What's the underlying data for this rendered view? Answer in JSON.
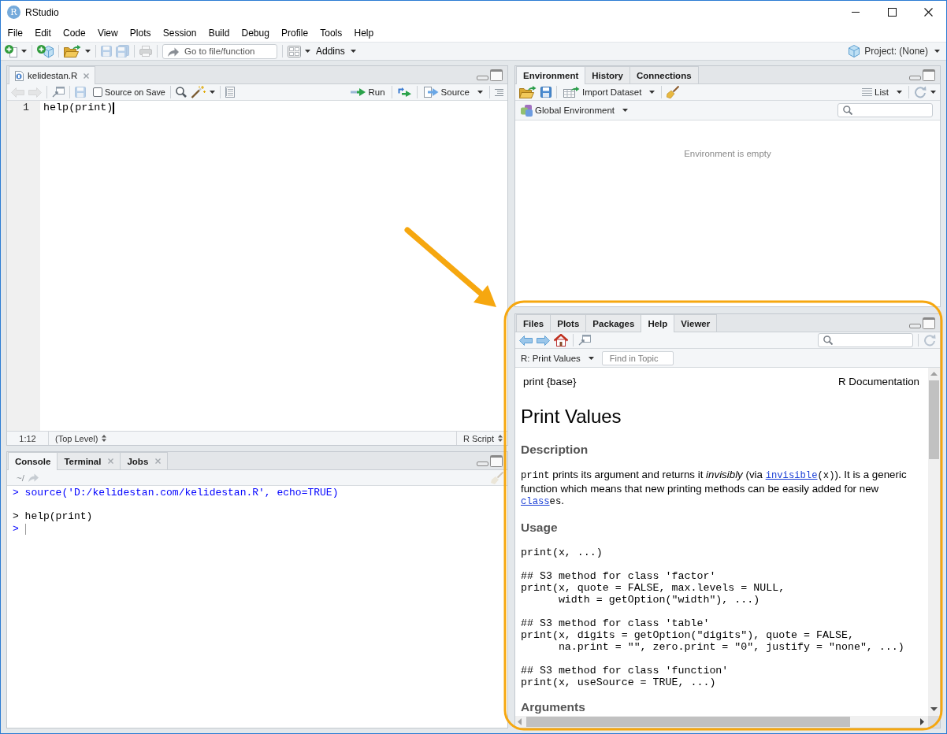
{
  "window": {
    "logo": "R",
    "title": "RStudio"
  },
  "menu": [
    "File",
    "Edit",
    "Code",
    "View",
    "Plots",
    "Session",
    "Build",
    "Debug",
    "Profile",
    "Tools",
    "Help"
  ],
  "toolbar": {
    "buttons": [
      {
        "kind": "new_file",
        "disabled": false
      },
      {
        "kind": "new_project",
        "disabled": false
      },
      {
        "kind": "open",
        "disabled": false
      },
      {
        "kind": "save",
        "disabled": true
      },
      {
        "kind": "save_all",
        "disabled": true
      },
      {
        "kind": "print",
        "disabled": true
      }
    ],
    "goto_placeholder": "Go to file/function",
    "addins": "Addins",
    "project": "Project: (None)"
  },
  "editor": {
    "tabs": [
      {
        "label": "kelidestan.R",
        "selected": true
      }
    ],
    "nav_disabled": true,
    "save_disabled": true,
    "source_on_save": {
      "label": "Source on Save",
      "checked": false
    },
    "run": "Run",
    "source": "Source",
    "lines": [
      {
        "number": "1",
        "code": "help(print)"
      }
    ],
    "status": {
      "position": "1:12",
      "scope": "(Top Level)",
      "file_type": "R Script"
    }
  },
  "console": {
    "tabs": [
      {
        "label": "Console",
        "selected": true,
        "closable": false
      },
      {
        "label": "Terminal",
        "selected": false,
        "closable": true
      },
      {
        "label": "Jobs",
        "selected": false,
        "closable": true
      }
    ],
    "path": "~/",
    "lines": [
      {
        "kind": "command",
        "text": "> source('D:/kelidestan.com/kelidestan.R', echo=TRUE)"
      },
      {
        "kind": "echo",
        "text": "> help(print)"
      },
      {
        "kind": "prompt",
        "text": ">"
      }
    ]
  },
  "environment": {
    "tabs": [
      {
        "label": "Environment",
        "selected": true
      },
      {
        "label": "History",
        "selected": false
      },
      {
        "label": "Connections",
        "selected": false
      }
    ],
    "import": "Import Dataset",
    "view": "List",
    "scope": "Global Environment",
    "empty_text": "Environment is empty"
  },
  "help": {
    "tabs": [
      {
        "label": "Files",
        "selected": false
      },
      {
        "label": "Plots",
        "selected": false
      },
      {
        "label": "Packages",
        "selected": false
      },
      {
        "label": "Help",
        "selected": true
      },
      {
        "label": "Viewer",
        "selected": false
      }
    ],
    "topic": "R: Print Values",
    "find_placeholder": "Find in Topic",
    "doc": {
      "package": "print {base}",
      "source": "R Documentation",
      "title": "Print Values",
      "sections": [
        {
          "heading": "Description",
          "kind": "paragraph",
          "parts": [
            {
              "kind": "code",
              "text": "print"
            },
            {
              "kind": "text",
              "text": " prints its argument and returns it "
            },
            {
              "kind": "italic",
              "text": "invisibly"
            },
            {
              "kind": "text",
              "text": " (via "
            },
            {
              "kind": "link",
              "text": "invisible"
            },
            {
              "kind": "code",
              "text": "(x)"
            },
            {
              "kind": "text",
              "text": "). It is a generic function which means that new printing methods can be easily added for new "
            },
            {
              "kind": "link",
              "text": "class"
            },
            {
              "kind": "code",
              "text": "es"
            },
            {
              "kind": "text",
              "text": "."
            }
          ]
        },
        {
          "heading": "Usage",
          "kind": "code",
          "code": "print(x, ...)\n\n## S3 method for class 'factor'\nprint(x, quote = FALSE, max.levels = NULL,\n      width = getOption(\"width\"), ...)\n\n## S3 method for class 'table'\nprint(x, digits = getOption(\"digits\"), quote = FALSE,\n      na.print = \"\", zero.print = \"0\", justify = \"none\", ...)\n\n## S3 method for class 'function'\nprint(x, useSource = TRUE, ...)"
        },
        {
          "heading": "Arguments",
          "kind": "heading"
        }
      ]
    }
  }
}
